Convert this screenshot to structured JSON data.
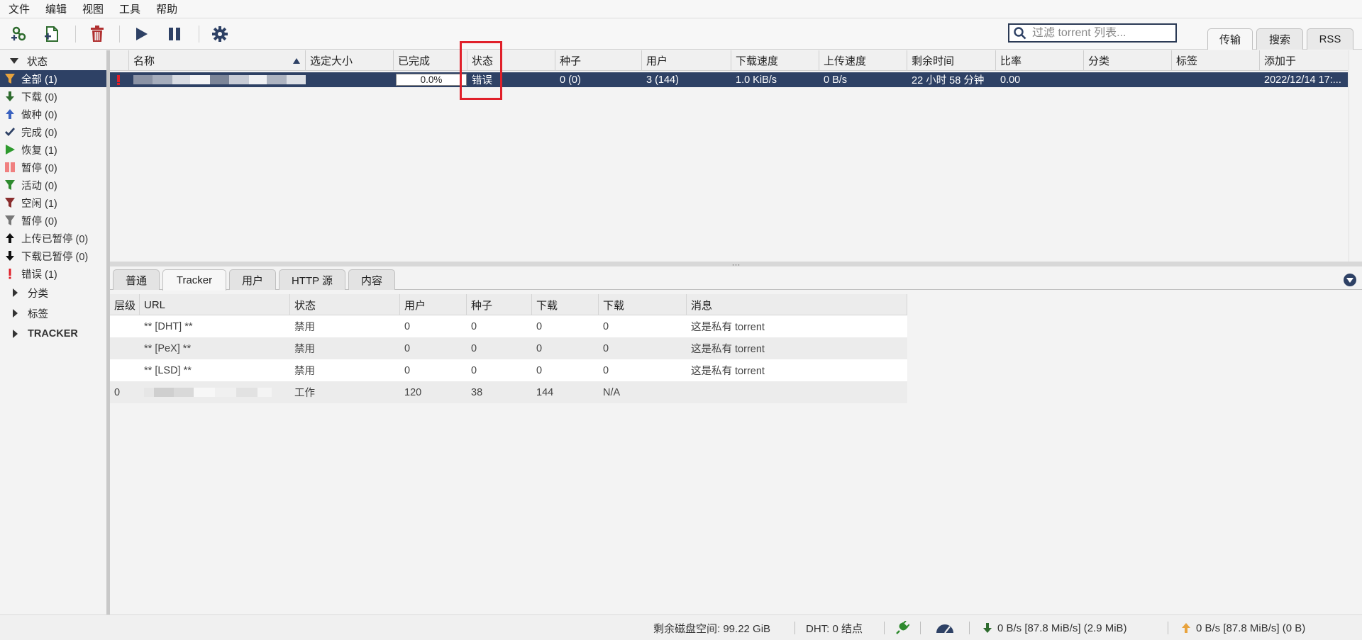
{
  "menu": [
    "文件",
    "编辑",
    "视图",
    "工具",
    "帮助"
  ],
  "toolbar": {
    "search_placeholder": "过滤 torrent 列表...",
    "tabs": [
      "传输",
      "搜索",
      "RSS"
    ]
  },
  "sidebar": {
    "status_header": "状态",
    "items": [
      {
        "label": "全部 (1)",
        "icon": "filter-icon"
      },
      {
        "label": "下载 (0)",
        "icon": "download-arrow-icon"
      },
      {
        "label": "做种 (0)",
        "icon": "upload-arrow-icon"
      },
      {
        "label": "完成 (0)",
        "icon": "checkmark-icon"
      },
      {
        "label": "恢复 (1)",
        "icon": "play-icon"
      },
      {
        "label": "暂停 (0)",
        "icon": "pause-icon"
      },
      {
        "label": "活动 (0)",
        "icon": "filter-icon"
      },
      {
        "label": "空闲 (1)",
        "icon": "filter-icon"
      },
      {
        "label": "暂停 (0)",
        "icon": "filter-icon"
      },
      {
        "label": "上传已暂停 (0)",
        "icon": "upload-arrow-icon"
      },
      {
        "label": "下载已暂停 (0)",
        "icon": "download-arrow-icon"
      },
      {
        "label": "错误 (1)",
        "icon": "error-icon"
      }
    ],
    "categories_header": "分类",
    "tags_header": "标签",
    "tracker_header": "TRACKER"
  },
  "torrent_table": {
    "headers": [
      "名称",
      "选定大小",
      "已完成",
      "状态",
      "种子",
      "用户",
      "下载速度",
      "上传速度",
      "剩余时间",
      "比率",
      "分类",
      "标签",
      "添加于"
    ],
    "row": {
      "progress": "0.0%",
      "progress_value": 0,
      "status": "错误",
      "seeds": "0 (0)",
      "peers": "3 (144)",
      "down_speed": "1.0 KiB/s",
      "up_speed": "0 B/s",
      "eta": "22 小时 58 分钟",
      "ratio": "0.00",
      "category": "",
      "tags": "",
      "added_on": "2022/12/14 17:..."
    }
  },
  "detail": {
    "tabs": [
      "普通",
      "Tracker",
      "用户",
      "HTTP 源",
      "内容"
    ],
    "active_tab": "Tracker",
    "tracker_headers": [
      "层级",
      "URL",
      "状态",
      "用户",
      "种子",
      "下载",
      "下载",
      "消息"
    ],
    "tracker_rows": [
      {
        "tier": "",
        "url": "** [DHT] **",
        "status": "禁用",
        "peers": "0",
        "seeds": "0",
        "leeches": "0",
        "downloaded": "0",
        "message": "这是私有 torrent"
      },
      {
        "tier": "",
        "url": "** [PeX] **",
        "status": "禁用",
        "peers": "0",
        "seeds": "0",
        "leeches": "0",
        "downloaded": "0",
        "message": "这是私有 torrent"
      },
      {
        "tier": "",
        "url": "** [LSD] **",
        "status": "禁用",
        "peers": "0",
        "seeds": "0",
        "leeches": "0",
        "downloaded": "0",
        "message": "这是私有 torrent"
      },
      {
        "tier": "0",
        "url": "",
        "status": "工作",
        "peers": "120",
        "seeds": "38",
        "leeches": "144",
        "downloaded": "N/A",
        "message": ""
      }
    ]
  },
  "statusbar": {
    "free_space": "剩余磁盘空间: 99.22 GiB",
    "dht": "DHT: 0 结点",
    "download": "0 B/s [87.8 MiB/s] (2.9 MiB)",
    "upload": "0 B/s [87.8 MiB/s] (0 B)"
  },
  "colors": {
    "selection": "#2e4165",
    "highlight_border": "#e0202a",
    "error": "#e0202a"
  }
}
